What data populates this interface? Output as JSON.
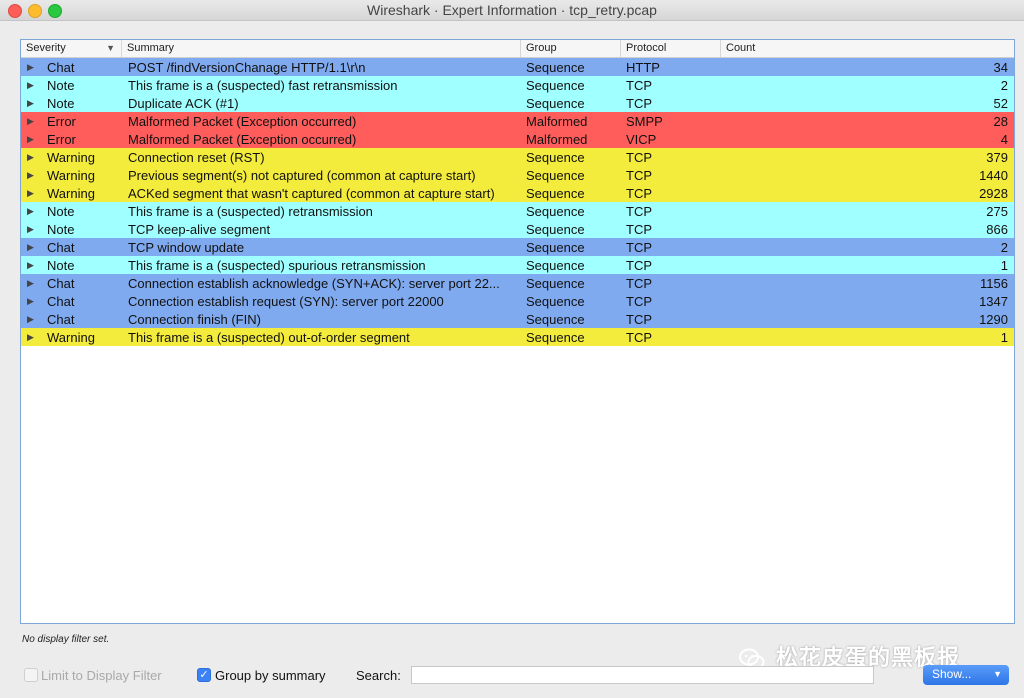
{
  "window": {
    "title": "Wireshark · Expert Information · tcp_retry.pcap"
  },
  "columns": {
    "severity": "Severity",
    "summary": "Summary",
    "group": "Group",
    "protocol": "Protocol",
    "count": "Count"
  },
  "severity_colors": {
    "Chat": "#80aaf0",
    "Note": "#a0ffff",
    "Error": "#ff5c5c",
    "Warning": "#f4ec3c"
  },
  "rows": [
    {
      "severity": "Chat",
      "summary": "POST /findVersionChanage HTTP/1.1\\r\\n",
      "group": "Sequence",
      "protocol": "HTTP",
      "count": "34"
    },
    {
      "severity": "Note",
      "summary": "This frame is a (suspected) fast retransmission",
      "group": "Sequence",
      "protocol": "TCP",
      "count": "2"
    },
    {
      "severity": "Note",
      "summary": "Duplicate ACK (#1)",
      "group": "Sequence",
      "protocol": "TCP",
      "count": "52"
    },
    {
      "severity": "Error",
      "summary": "Malformed Packet (Exception occurred)",
      "group": "Malformed",
      "protocol": "SMPP",
      "count": "28"
    },
    {
      "severity": "Error",
      "summary": "Malformed Packet (Exception occurred)",
      "group": "Malformed",
      "protocol": "VICP",
      "count": "4"
    },
    {
      "severity": "Warning",
      "summary": "Connection reset (RST)",
      "group": "Sequence",
      "protocol": "TCP",
      "count": "379"
    },
    {
      "severity": "Warning",
      "summary": "Previous segment(s) not captured (common at capture start)",
      "group": "Sequence",
      "protocol": "TCP",
      "count": "1440"
    },
    {
      "severity": "Warning",
      "summary": "ACKed segment that wasn't captured (common at capture start)",
      "group": "Sequence",
      "protocol": "TCP",
      "count": "2928"
    },
    {
      "severity": "Note",
      "summary": "This frame is a (suspected) retransmission",
      "group": "Sequence",
      "protocol": "TCP",
      "count": "275"
    },
    {
      "severity": "Note",
      "summary": "TCP keep-alive segment",
      "group": "Sequence",
      "protocol": "TCP",
      "count": "866"
    },
    {
      "severity": "Chat",
      "summary": "TCP window update",
      "group": "Sequence",
      "protocol": "TCP",
      "count": "2"
    },
    {
      "severity": "Note",
      "summary": "This frame is a (suspected) spurious retransmission",
      "group": "Sequence",
      "protocol": "TCP",
      "count": "1"
    },
    {
      "severity": "Chat",
      "summary": "Connection establish acknowledge (SYN+ACK): server port 22...",
      "group": "Sequence",
      "protocol": "TCP",
      "count": "1156"
    },
    {
      "severity": "Chat",
      "summary": "Connection establish request (SYN): server port 22000",
      "group": "Sequence",
      "protocol": "TCP",
      "count": "1347"
    },
    {
      "severity": "Chat",
      "summary": "Connection finish (FIN)",
      "group": "Sequence",
      "protocol": "TCP",
      "count": "1290"
    },
    {
      "severity": "Warning",
      "summary": "This frame is a (suspected) out-of-order segment",
      "group": "Sequence",
      "protocol": "TCP",
      "count": "1"
    }
  ],
  "status": {
    "filter_text": "No display filter set."
  },
  "controls": {
    "limit_label": "Limit to Display Filter",
    "limit_checked": false,
    "group_label": "Group by summary",
    "group_checked": true,
    "search_label": "Search:",
    "search_value": "",
    "show_label": "Show..."
  },
  "watermark": {
    "text": "松花皮蛋的黑板报"
  }
}
